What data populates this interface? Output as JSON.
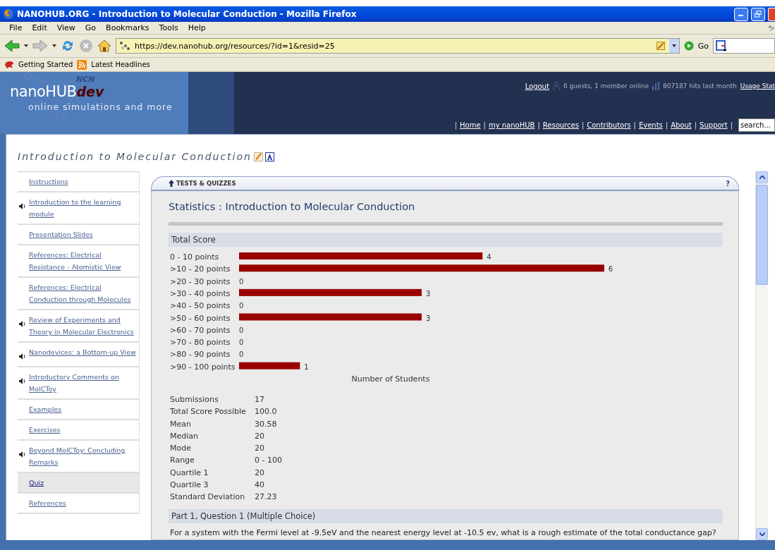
{
  "window": {
    "title": "NANOHUB.ORG - Introduction to Molecular Conduction - Mozilla Firefox"
  },
  "menu": [
    "File",
    "Edit",
    "View",
    "Go",
    "Bookmarks",
    "Tools",
    "Help"
  ],
  "address": {
    "url": "https://dev.nanohub.org/resources/?id=1&resid=25"
  },
  "go_button": "Go",
  "bookmarks": [
    "Getting Started",
    "Latest Headlines"
  ],
  "header": {
    "logo": {
      "name": "nanoHUB",
      "suffix": "dev",
      "org": "NCN",
      "tagline": "online simulations and more"
    },
    "logout": "Logout",
    "online": "6 guests, 1 member online",
    "hits": "807187 hits last month",
    "usage": "Usage Stat",
    "separator": "|",
    "nav": [
      "Home",
      "my nanoHUB",
      "Resources",
      "Contributors",
      "Events",
      "About",
      "Support"
    ],
    "search": {
      "placeholder": "search..."
    }
  },
  "page_title": "Introduction to Molecular Conduction",
  "sidebar": {
    "items": [
      {
        "label": "Instructions",
        "kind": "page",
        "selected": false
      },
      {
        "label": "Introduction to the learning module",
        "kind": "audio",
        "selected": false
      },
      {
        "label": "Presentation Slides",
        "kind": "page",
        "selected": false
      },
      {
        "label": "References: Electrical Resistance - Atomistic View",
        "kind": "page",
        "selected": false
      },
      {
        "label": "References: Electrical Conduction through Molecules",
        "kind": "page",
        "selected": false
      },
      {
        "label": "Review of Experiments and Theory in Molecular Electronics",
        "kind": "audio",
        "selected": false
      },
      {
        "label": "Nanodevices: a Bottom-up View",
        "kind": "audio",
        "selected": false
      },
      {
        "label": "Introductory Comments on MolCToy",
        "kind": "audio",
        "selected": false
      },
      {
        "label": "Examples",
        "kind": "page",
        "selected": false
      },
      {
        "label": "Exercises",
        "kind": "page",
        "selected": false
      },
      {
        "label": "Beyond MolCToy: Concluding Remarks",
        "kind": "audio",
        "selected": false
      },
      {
        "label": "Quiz",
        "kind": "page",
        "selected": true
      },
      {
        "label": "References",
        "kind": "page",
        "selected": false
      }
    ]
  },
  "panel": {
    "tab": "TESTS & QUIZZES",
    "help": "?",
    "heading": "Statistics : Introduction to Molecular Conduction",
    "score_section": {
      "title": "Total Score",
      "chart_data": {
        "type": "bar",
        "orientation": "horizontal",
        "xlabel": "Number of Students",
        "categories": [
          "0 - 10 points",
          ">10 - 20 points",
          ">20 - 30 points",
          ">30 - 40 points",
          ">40 - 50 points",
          ">50 - 60 points",
          ">60 - 70 points",
          ">70 - 80 points",
          ">80 - 90 points",
          ">90 - 100 points"
        ],
        "values": [
          4,
          6,
          0,
          3,
          0,
          3,
          0,
          0,
          0,
          1
        ],
        "data_labels": true
      },
      "stats": [
        {
          "label": "Submissions",
          "value": "17"
        },
        {
          "label": "Total Score Possible",
          "value": "100.0"
        },
        {
          "label": "Mean",
          "value": "30.58"
        },
        {
          "label": "Median",
          "value": "20"
        },
        {
          "label": "Mode",
          "value": "20"
        },
        {
          "label": "Range",
          "value": "0 - 100"
        },
        {
          "label": "Quartile 1",
          "value": "20"
        },
        {
          "label": "Quartile 3",
          "value": "40"
        },
        {
          "label": "Standard Deviation",
          "value": "27.23"
        }
      ]
    },
    "question_section": {
      "title": "Part 1, Question 1 (Multiple Choice)",
      "text": "For a system with the Fermi level at -9.5eV and the nearest energy level at -10.5 ev, what is a rough estimate of the total conductance gap?"
    }
  }
}
